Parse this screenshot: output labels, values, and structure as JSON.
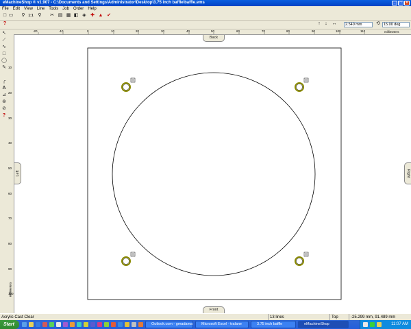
{
  "window": {
    "title": "eMachineShop ® v1.907 - C:\\Documents and Settings\\Administrator\\Desktop\\3.75 inch baffle\\baffle.ems",
    "min_glyph": "_",
    "max_glyph": "□",
    "close_glyph": "×"
  },
  "menu": [
    "File",
    "Edit",
    "View",
    "Line",
    "Tools",
    "Job",
    "Order",
    "Help"
  ],
  "toolbar": {
    "icons": [
      {
        "name": "new-icon",
        "glyph": "□"
      },
      {
        "name": "open-icon",
        "glyph": "▭"
      },
      {
        "name": "zoom-icon",
        "glyph": "⚲"
      },
      {
        "name": "fit-icon",
        "glyph": "1:1"
      },
      {
        "name": "zoom-area-icon",
        "glyph": "⚲"
      },
      {
        "name": "cut-icon",
        "glyph": "✂"
      },
      {
        "name": "print-icon",
        "glyph": "▤"
      },
      {
        "name": "properties-icon",
        "glyph": "▦"
      },
      {
        "name": "layers-icon",
        "glyph": "◧"
      },
      {
        "name": "material-icon",
        "glyph": "◈"
      },
      {
        "name": "price-icon",
        "glyph": "✚"
      },
      {
        "name": "3d-view-icon",
        "glyph": "▲"
      },
      {
        "name": "check-icon",
        "glyph": "✔"
      }
    ],
    "help_glyph": "?",
    "step_value": "2.540 mm",
    "angle_value": "15.00 deg"
  },
  "left_tools": [
    "↖",
    "⟋",
    "∿",
    "□",
    "◯",
    "✎",
    "╭",
    "A",
    "⊿",
    "⊕",
    "⊘",
    "?"
  ],
  "ruler": {
    "x_ticks": [
      "-20",
      "-10",
      "0",
      "10",
      "20",
      "30",
      "40",
      "50",
      "60",
      "70",
      "80",
      "90",
      "100",
      "110"
    ],
    "x_unit": "millimeters",
    "y_ticks": [
      "10",
      "20",
      "30",
      "40",
      "50",
      "60",
      "70",
      "80",
      "90",
      "100"
    ],
    "y_unit": "millimeters"
  },
  "views": {
    "back": "Back",
    "front": "Front",
    "left": "Left",
    "right": "Right"
  },
  "status": {
    "material": "Acrylic Cast Clear",
    "lines": "13 lines",
    "view": "Top",
    "coords": "-25.299 mm, 91.489 mm"
  },
  "taskbar": {
    "start": "Start",
    "tasks": [
      "Outlook.com - gmadama...",
      "Microsoft Excel - tralane",
      "3.75 inch baffle",
      "eMachineShop"
    ],
    "time": "11:07 AM"
  },
  "colors": {
    "title": "#0a5ee0",
    "taskbar": "#245edb",
    "canvas": "#ffffff"
  }
}
